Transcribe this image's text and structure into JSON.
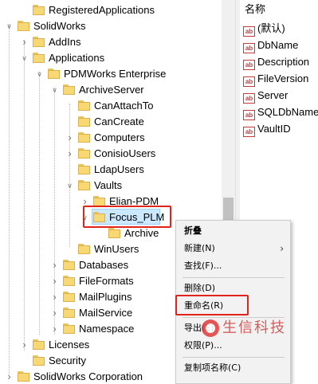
{
  "tree": {
    "items": [
      {
        "label": "RegisteredApplications",
        "level": 1,
        "expander": ""
      },
      {
        "label": "SolidWorks",
        "level": 0,
        "expander": "open"
      },
      {
        "label": "AddIns",
        "level": 1,
        "expander": "closed"
      },
      {
        "label": "Applications",
        "level": 1,
        "expander": "open"
      },
      {
        "label": "PDMWorks Enterprise",
        "level": 2,
        "expander": "open"
      },
      {
        "label": "ArchiveServer",
        "level": 3,
        "expander": "open"
      },
      {
        "label": "CanAttachTo",
        "level": 4,
        "expander": ""
      },
      {
        "label": "CanCreate",
        "level": 4,
        "expander": ""
      },
      {
        "label": "Computers",
        "level": 4,
        "expander": "closed"
      },
      {
        "label": "ConisioUsers",
        "level": 4,
        "expander": "closed"
      },
      {
        "label": "LdapUsers",
        "level": 4,
        "expander": ""
      },
      {
        "label": "Vaults",
        "level": 4,
        "expander": "open"
      },
      {
        "label": "Elian-PDM",
        "level": 5,
        "expander": "closed"
      },
      {
        "label": "Focus_PLM",
        "level": 5,
        "expander": "open"
      },
      {
        "label": "Archive",
        "level": 6,
        "expander": ""
      },
      {
        "label": "WinUsers",
        "level": 4,
        "expander": ""
      },
      {
        "label": "Databases",
        "level": 3,
        "expander": "closed"
      },
      {
        "label": "FileFormats",
        "level": 3,
        "expander": "closed"
      },
      {
        "label": "MailPlugins",
        "level": 3,
        "expander": "closed"
      },
      {
        "label": "MailService",
        "level": 3,
        "expander": "closed"
      },
      {
        "label": "Namespace",
        "level": 3,
        "expander": "closed"
      },
      {
        "label": "Licenses",
        "level": 1,
        "expander": "closed"
      },
      {
        "label": "Security",
        "level": 1,
        "expander": ""
      },
      {
        "label": "SolidWorks Corporation",
        "level": 0,
        "expander": "closed"
      }
    ]
  },
  "values_pane": {
    "header": "名称",
    "icon_text": "ab",
    "items": [
      "(默认)",
      "DbName",
      "Description",
      "FileVersion",
      "Server",
      "SQLDbName",
      "VaultID"
    ]
  },
  "context_menu": {
    "items": [
      {
        "label": "折叠",
        "bold": true
      },
      {
        "label": "新建(N)",
        "submenu": true
      },
      {
        "label": "查找(F)..."
      },
      {
        "label": "删除(D)"
      },
      {
        "label": "重命名(R)"
      },
      {
        "label": "导出(E)"
      },
      {
        "label": "权限(P)..."
      },
      {
        "label": "复制项名称(C)"
      }
    ],
    "submenu_arrow": "›"
  },
  "watermark": {
    "text": "生信科技"
  },
  "colors": {
    "selection": "#cce8ff",
    "highlight_border": "#e0241c",
    "folder": "#f8d775"
  }
}
